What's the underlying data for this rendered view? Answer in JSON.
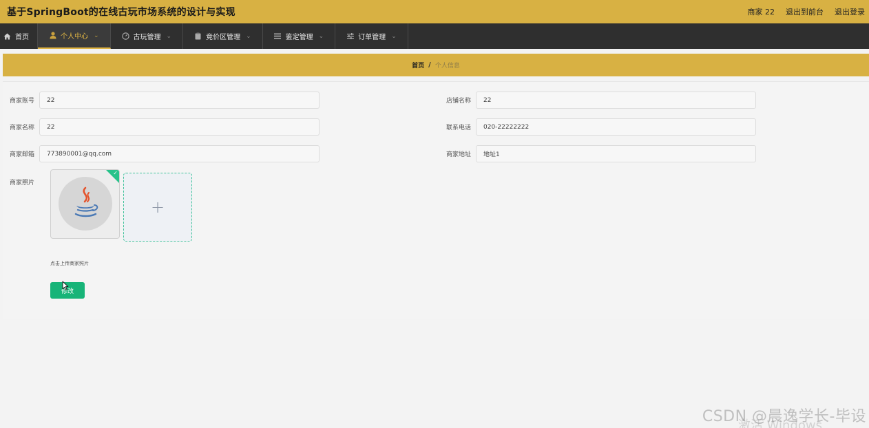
{
  "header": {
    "title": "基于SpringBoot的在线古玩市场系统的设计与实现",
    "user": "商家 22",
    "to_front": "退出到前台",
    "logout": "退出登录"
  },
  "nav": {
    "items": [
      {
        "label": "首页",
        "icon": "home-icon"
      },
      {
        "label": "个人中心",
        "icon": "user-icon"
      },
      {
        "label": "古玩管理",
        "icon": "gauge-icon"
      },
      {
        "label": "竞价区管理",
        "icon": "clipboard-icon"
      },
      {
        "label": "鉴定管理",
        "icon": "list-icon"
      },
      {
        "label": "订单管理",
        "icon": "sliders-icon"
      }
    ],
    "active": "个人中心"
  },
  "breadcrumb": {
    "home": "首页",
    "separator": "/",
    "current": "个人信息"
  },
  "form": {
    "fields": [
      {
        "label": "商家账号",
        "value": "22"
      },
      {
        "label": "店铺名称",
        "value": "22"
      },
      {
        "label": "商家名称",
        "value": "22"
      },
      {
        "label": "联系电话",
        "value": "020-22222222"
      },
      {
        "label": "商家邮箱",
        "value": "773890001@qq.com"
      },
      {
        "label": "商家地址",
        "value": "地址1"
      }
    ],
    "photo_label": "商家照片",
    "upload_tip": "点击上传商家照片",
    "submit_label": "修改"
  },
  "watermark": {
    "text": "CSDN @晨逸学长-毕设",
    "overlay": "激活 Windows"
  },
  "colors": {
    "header_bg": "#d8b143",
    "nav_bg": "#2f2f2f",
    "accent": "#e0b544",
    "button": "#17b478",
    "upload_border": "#3ec29a"
  }
}
